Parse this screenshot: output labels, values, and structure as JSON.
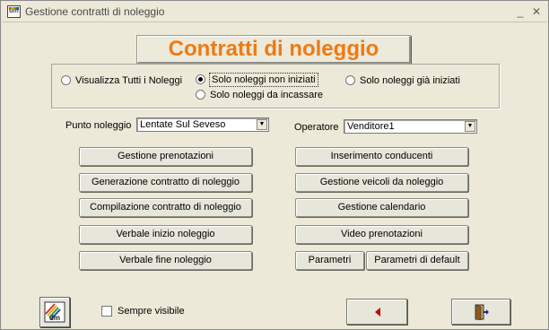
{
  "window": {
    "title": "Gestione contratti di noleggio",
    "icon_text": "dm",
    "minimize_glyph": "_",
    "close_glyph": "✕"
  },
  "header": {
    "title": "Contratti di noleggio",
    "title_color": "#f07a12"
  },
  "filter": {
    "options": [
      {
        "label": "Visualizza Tutti i Noleggi",
        "selected": false
      },
      {
        "label": "Solo noleggi non iniziati",
        "selected": true
      },
      {
        "label": "Solo noleggi già iniziati",
        "selected": false
      },
      {
        "label": "Solo noleggi  da incassare",
        "selected": false
      }
    ]
  },
  "punto_noleggio": {
    "label": "Punto noleggio",
    "value": "Lentate Sul Seveso",
    "arrow": "▼"
  },
  "operatore": {
    "label": "Operatore",
    "value": "Venditore1",
    "arrow": "▼"
  },
  "buttons": {
    "left": [
      "Gestione prenotazioni",
      "Generazione contratto di noleggio",
      "Compilazione contratto di noleggio",
      "Verbale inizio noleggio",
      "Verbale fine noleggio"
    ],
    "right": [
      "Inserimento conducenti",
      "Gestione veicoli da noleggio",
      "Gestione calendario",
      "Video prenotazioni"
    ],
    "parametri": "Parametri",
    "parametri_default": "Parametri di default"
  },
  "footer": {
    "logo_text": "dm",
    "sempre_visibile_label": "Sempre visibile",
    "sempre_visibile_checked": false,
    "back_icon": "arrow-left-icon",
    "exit_icon": "exit-door-icon"
  }
}
